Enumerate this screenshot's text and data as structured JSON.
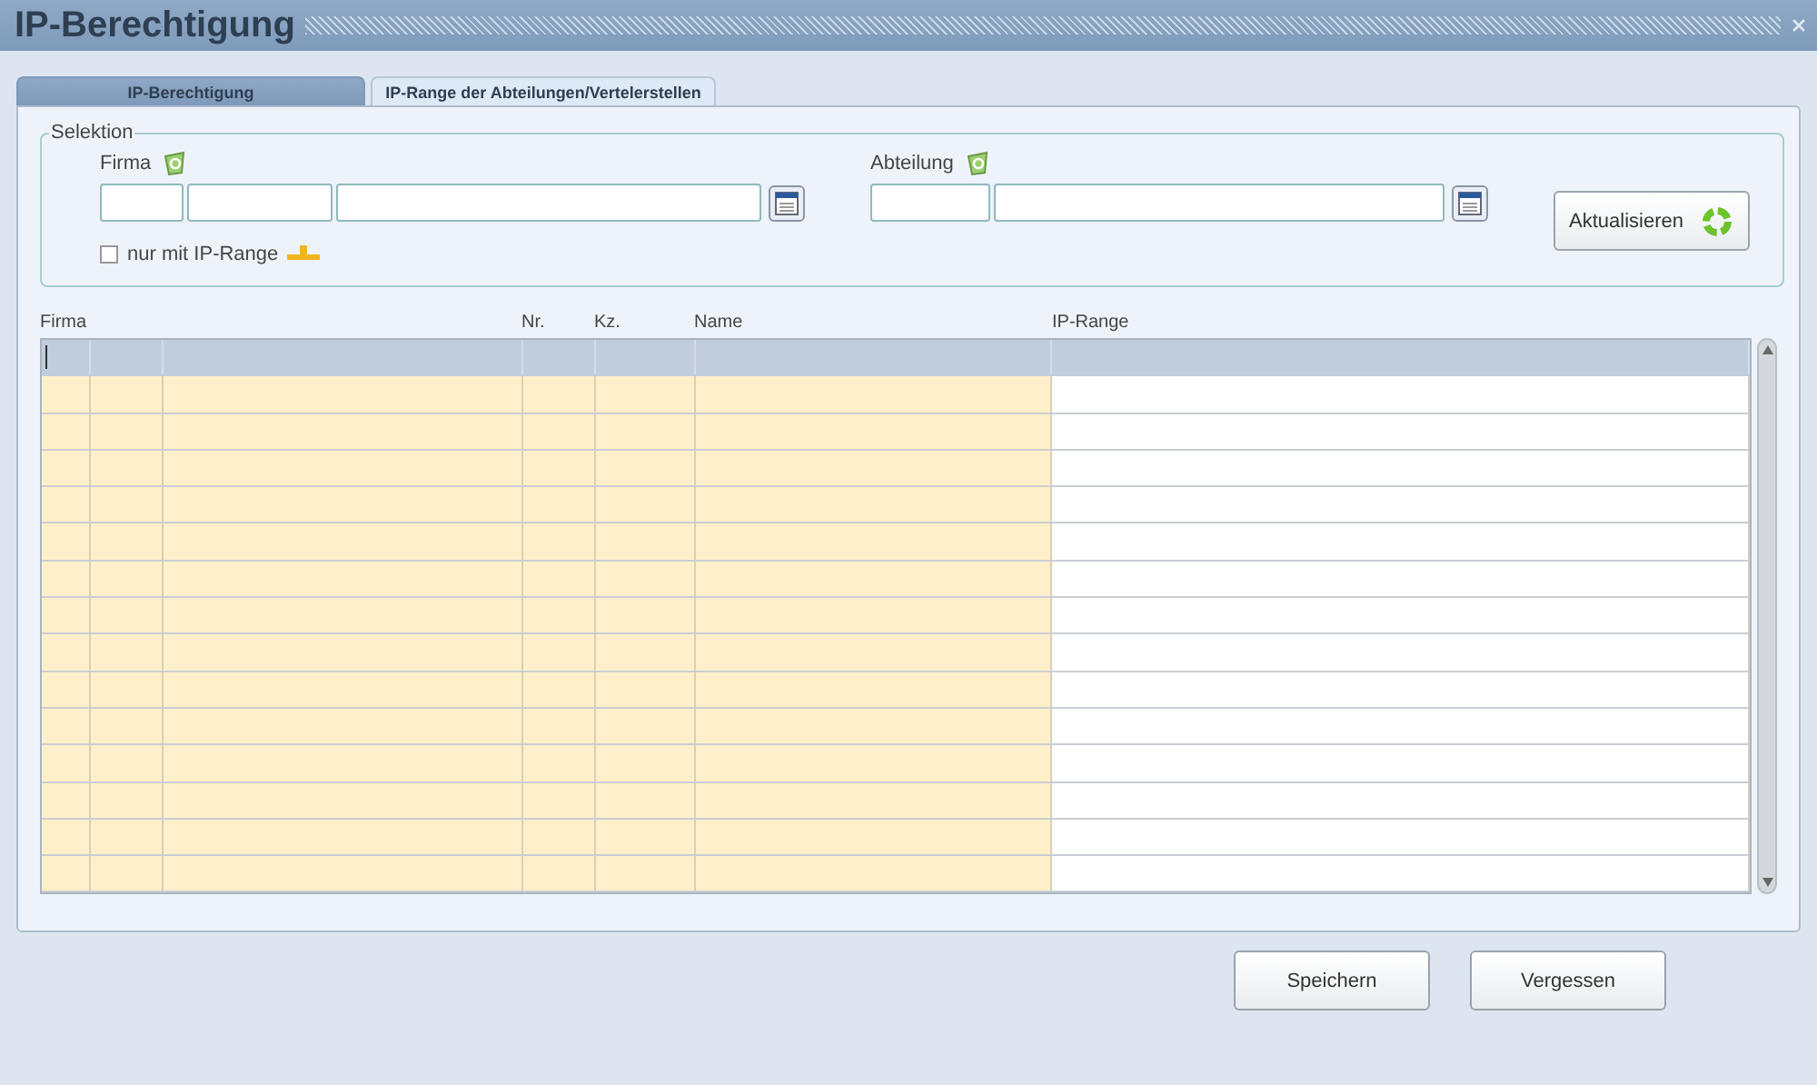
{
  "window": {
    "title": "IP-Berechtigung"
  },
  "tabs": [
    {
      "label": "IP-Berechtigung",
      "selected": true
    },
    {
      "label": "IP-Range der Abteilungen/Vertelerstellen",
      "selected": false
    }
  ],
  "selection": {
    "legend": "Selektion",
    "firma_label": "Firma",
    "abteilung_label": "Abteilung",
    "only_ip_range": {
      "label": "nur mit IP-Range",
      "checked": false
    },
    "refresh_button": "Aktualisieren"
  },
  "table": {
    "columns": [
      {
        "label": "Firma"
      },
      {},
      {},
      {
        "label": "Nr."
      },
      {
        "label": "Kz."
      },
      {
        "label": "Name"
      },
      {
        "label": "IP-Range"
      }
    ],
    "rows": [
      {
        "selected": true
      },
      {
        "selected": false
      },
      {
        "selected": false
      },
      {
        "selected": false
      },
      {
        "selected": false
      },
      {
        "selected": false
      },
      {
        "selected": false
      },
      {
        "selected": false
      },
      {
        "selected": false
      },
      {
        "selected": false
      },
      {
        "selected": false
      },
      {
        "selected": false
      },
      {
        "selected": false
      },
      {
        "selected": false
      },
      {
        "selected": false
      }
    ]
  },
  "buttons": [
    "Speichern",
    "Vergessen"
  ]
}
